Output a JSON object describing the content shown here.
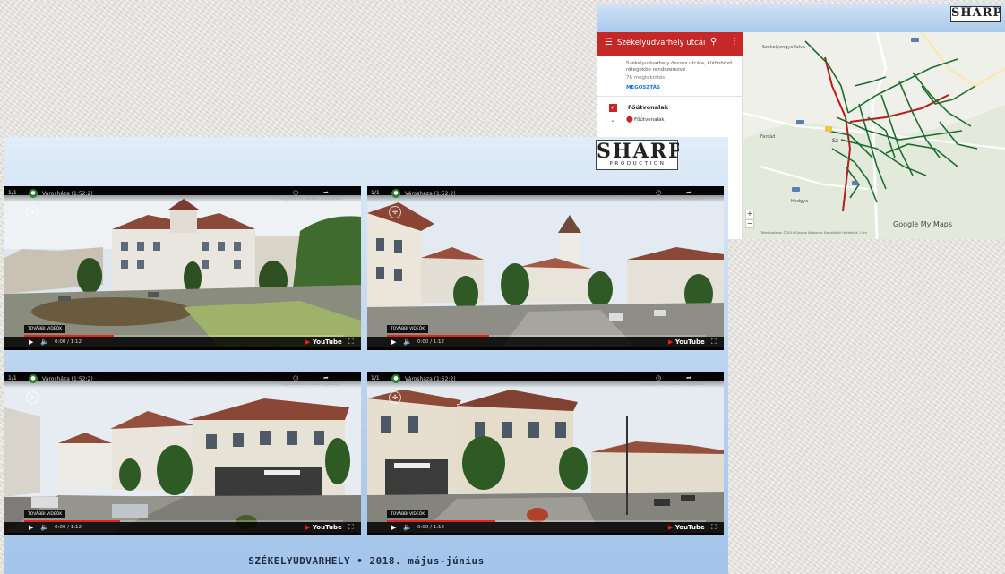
{
  "map_window": {
    "logo": "SHARP",
    "sidebar": {
      "title": "Székelyudvarhely utcái",
      "description": "Székelyudvarhely összes utcája, különböző rétegekbe rendszerezve",
      "views": "76 megtekintés",
      "share_label": "MEGOSZTÁS",
      "layer_title": "Főútvonalak",
      "layer_item": "Főútvonalak"
    },
    "map": {
      "places": [
        "Székelyengyelfalva",
        "Farcád",
        "Hodgya",
        "Sz"
      ],
      "branding": "Google My Maps",
      "footer": "Térképadatok ©2019 Google   Általános Szerződési Feltételek   1 km"
    },
    "icons": [
      "menu-icon",
      "search-icon",
      "more-vert-icon",
      "check-icon",
      "chevron-down-icon",
      "pin-icon",
      "zoom-in-icon",
      "zoom-out-icon"
    ]
  },
  "video_window": {
    "logo_word": "SHARP",
    "logo_sub": "PRODUCTION",
    "caption": "SZÉKELYUDVARHELY • 2018. május-június",
    "players": [
      {
        "counter": "1/1",
        "title": "Városháza (1:52:2)",
        "badge": "TOVÁBBI VIDEÓK",
        "time": "0:00 / 1:12",
        "brand": "YouTube",
        "top_label": "Megtekintés később  Megosztás",
        "progress": 0.28
      },
      {
        "counter": "1/1",
        "title": "Városháza (1:52:2)",
        "badge": "TOVÁBBI VIDEÓK",
        "time": "0:00 / 1:12",
        "brand": "YouTube",
        "top_label": "Megtekintés később  Megosztás",
        "progress": 0.32
      },
      {
        "counter": "1/1",
        "title": "Városháza (1:52:2)",
        "badge": "TOVÁBBI VIDEÓK",
        "time": "0:00 / 1:12",
        "brand": "YouTube",
        "top_label": "Megtekintés később  Megosztás",
        "progress": 0.3
      },
      {
        "counter": "1/1",
        "title": "Városháza (1:52:2)",
        "badge": "TOVÁBBI VIDEÓK",
        "time": "0:00 / 1:12",
        "brand": "YouTube",
        "top_label": "Megtekintés később  Megosztás",
        "progress": 0.34
      }
    ]
  },
  "colors": {
    "maps_red": "#c62828",
    "road_green": "#1b6e2e",
    "youtube_red": "#e62117",
    "banner_blue": "#a9c9ec"
  }
}
